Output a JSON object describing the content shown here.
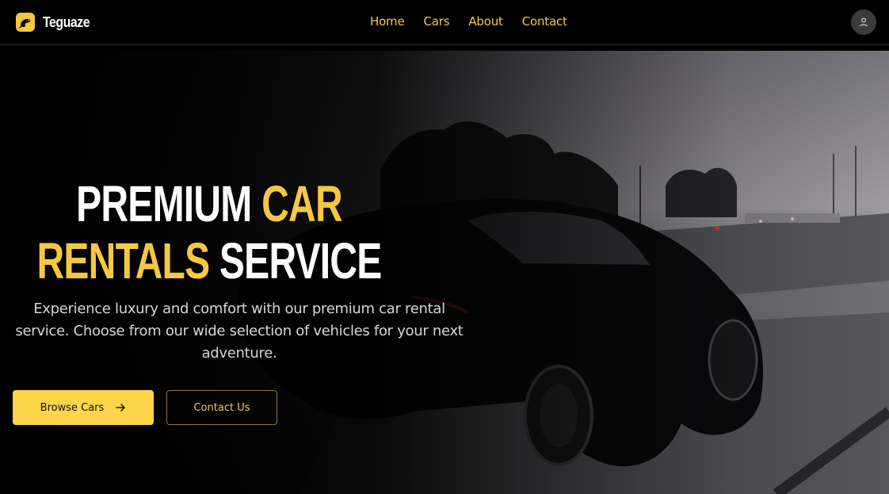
{
  "brand": {
    "name": "Teguaze",
    "logo_icon": "lizard-logo-icon"
  },
  "nav": {
    "items": [
      "Home",
      "Cars",
      "About",
      "Contact"
    ]
  },
  "user": {
    "icon": "user-icon"
  },
  "hero": {
    "headline_word_1": "PREMIUM",
    "headline_word_2": "CAR",
    "headline_word_3": "RENTALS",
    "headline_word_4": "SERVICE",
    "subtext": "Experience luxury and comfort with our premium car rental service. Choose from our wide selection of vehicles for your next adventure.",
    "primary_button": "Browse Cars",
    "primary_button_icon": "arrow-right-icon",
    "secondary_button": "Contact Us",
    "background": "sports-car-on-road-image"
  },
  "colors": {
    "accent": "#f5c842",
    "background": "#000000",
    "text": "#ffffff"
  }
}
